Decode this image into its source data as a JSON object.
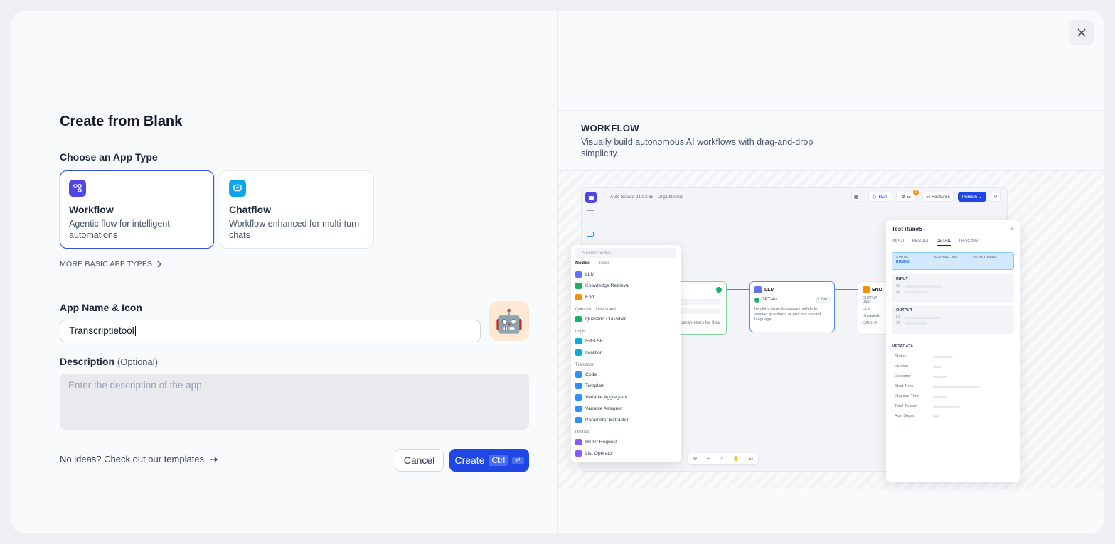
{
  "close": {
    "icon": "close-icon"
  },
  "title": "Create from Blank",
  "app_type": {
    "label": "Choose an App Type",
    "cards": [
      {
        "name": "Workflow",
        "desc": "Agentic flow for intelligent automations",
        "icon": "workflow-icon",
        "color": "#4f46e5",
        "selected": true
      },
      {
        "name": "Chatflow",
        "desc": "Workflow enhanced for multi-turn chats",
        "icon": "chatflow-icon",
        "color": "#0ba5ec",
        "selected": false
      }
    ],
    "more": "MORE BASIC APP TYPES"
  },
  "name_icon": {
    "label": "App Name & Icon",
    "value": "Transcriptietool",
    "avatar": "🤖"
  },
  "description": {
    "label": "Description",
    "optional": "(Optional)",
    "placeholder": "Enter the description of the app"
  },
  "footer": {
    "templates_link": "No ideas? Check out our templates",
    "cancel": "Cancel",
    "create": "Create",
    "shortcut_key": "Ctrl",
    "shortcut_enter": "↵"
  },
  "preview": {
    "title": "WORKFLOW",
    "desc": "Visually build autonomous AI workflows with drag-and-drop simplicity.",
    "autosave": "Auto-Saved 21:02:35 · Unpublished",
    "run": "Run",
    "features": "Features",
    "publish": "Publish",
    "badge": "2",
    "picker": {
      "search": "Search nodes...",
      "tabs": [
        "Nodes",
        "Tools"
      ],
      "items": [
        {
          "type": "item",
          "label": "LLM",
          "color": "#6172f3"
        },
        {
          "type": "item",
          "label": "Knowledge Retrieval",
          "color": "#16b364"
        },
        {
          "type": "item",
          "label": "End",
          "color": "#f79009"
        },
        {
          "type": "group",
          "label": "Question Understand"
        },
        {
          "type": "item",
          "label": "Question Classifier",
          "color": "#16b364"
        },
        {
          "type": "group",
          "label": "Logic"
        },
        {
          "type": "item",
          "label": "IF/ELSE",
          "color": "#06aed4"
        },
        {
          "type": "item",
          "label": "Iteration",
          "color": "#06aed4"
        },
        {
          "type": "group",
          "label": "Transform"
        },
        {
          "type": "item",
          "label": "Code",
          "color": "#2e90fa"
        },
        {
          "type": "item",
          "label": "Template",
          "color": "#2e90fa"
        },
        {
          "type": "item",
          "label": "Variable Aggregator",
          "color": "#2e90fa"
        },
        {
          "type": "item",
          "label": "Variable Assigner",
          "color": "#2e90fa"
        },
        {
          "type": "item",
          "label": "Parameter Extractor",
          "color": "#2e90fa"
        },
        {
          "type": "group",
          "label": "Utilities"
        },
        {
          "type": "item",
          "label": "HTTP Request",
          "color": "#875bf7"
        },
        {
          "type": "item",
          "label": "List Operator",
          "color": "#875bf7"
        }
      ]
    },
    "start_node": {
      "text": "parameters for flow"
    },
    "llm_node": {
      "title": "LLM",
      "model": "GPT-4o",
      "mode": "CHAT",
      "desc": "Invoking large language models to answer questions or process natural language"
    },
    "end_node": {
      "title": "END",
      "sub": "OUTPUT VARI",
      "rows": [
        "LLM",
        "Knowledg",
        "DALL-E"
      ]
    },
    "trace": {
      "title": "Test Run#5",
      "tabs": [
        "INPUT",
        "RESULT",
        "DETAIL",
        "TRACING"
      ],
      "status_label": "STATUS",
      "status_value": "RUNING",
      "elapsed_label": "ELAPSED TIME",
      "tokens_label": "TOTAL TOKENS",
      "input": "INPUT",
      "output": "OUTPUT",
      "v1": "$1",
      "v2": "$2",
      "metadata": "METADATA",
      "meta_rows": [
        "Status",
        "Version",
        "Executor",
        "Start Time",
        "Elapsed Time",
        "Total Tokens",
        "Run Steps"
      ]
    }
  }
}
